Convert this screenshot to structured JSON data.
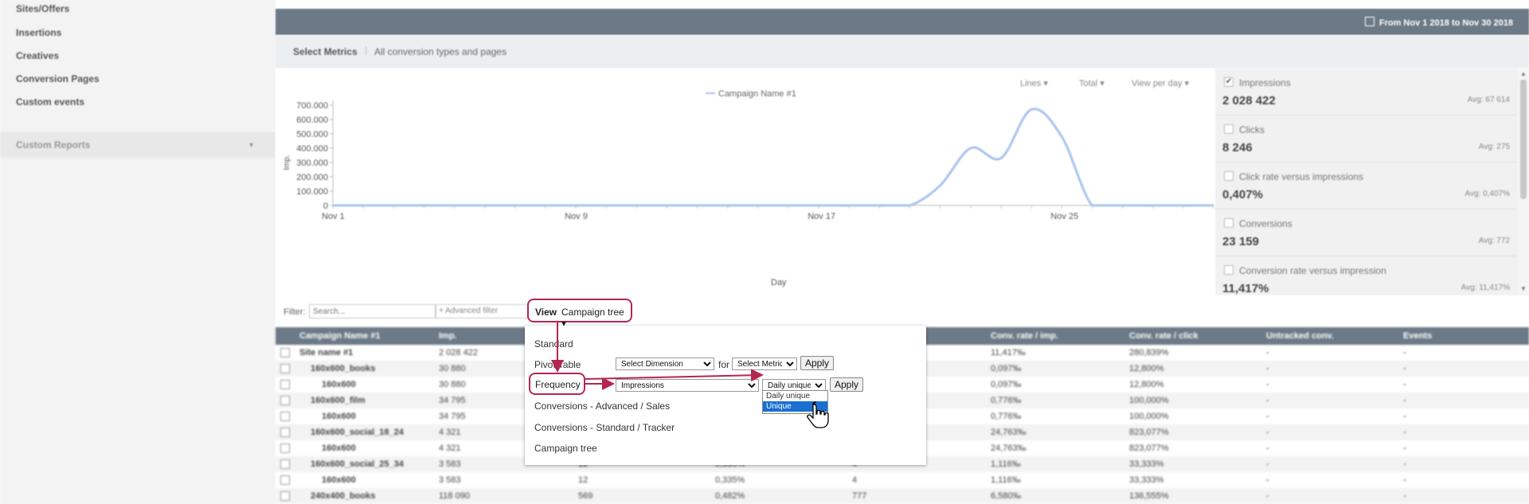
{
  "sidebar": {
    "items": [
      {
        "label": "Sites/Offers"
      },
      {
        "label": "Insertions"
      },
      {
        "label": "Creatives"
      },
      {
        "label": "Conversion Pages"
      },
      {
        "label": "Custom events"
      }
    ],
    "custom_reports": "Custom Reports"
  },
  "header": {
    "date_range": "From Nov 1 2018 to Nov 30 2018"
  },
  "metrics_bar": {
    "label": "Select Metrics",
    "separator": "|",
    "value": "All conversion types and pages"
  },
  "chart_controls": {
    "lines": "Lines ▾",
    "total": "Total ▾",
    "view": "View per day ▾"
  },
  "chart_data": {
    "type": "line",
    "legend": "Campaign Name #1",
    "xlabel": "Day",
    "ylabel": "Imp.",
    "x_ticks": [
      "Nov 1",
      "Nov 9",
      "Nov 17",
      "Nov 25"
    ],
    "y_ticks": [
      "700.000",
      "600.000",
      "500.000",
      "400.000",
      "300.000",
      "200.000",
      "100.000",
      "0"
    ],
    "ylim": [
      0,
      700000
    ],
    "series": [
      {
        "name": "Campaign Name #1",
        "color": "#a8c4ec",
        "x": [
          1,
          2,
          3,
          4,
          5,
          6,
          7,
          8,
          9,
          10,
          11,
          12,
          13,
          14,
          15,
          16,
          17,
          18,
          19,
          20,
          21,
          22,
          23,
          24,
          25,
          26,
          27,
          28,
          29,
          30
        ],
        "values": [
          0,
          0,
          0,
          0,
          0,
          0,
          0,
          0,
          0,
          0,
          0,
          0,
          0,
          0,
          0,
          0,
          0,
          0,
          0,
          0,
          140000,
          400000,
          330000,
          670000,
          480000,
          0,
          0,
          0,
          0,
          0
        ]
      }
    ]
  },
  "metric_cards": [
    {
      "name": "Impressions",
      "value": "2 028 422",
      "avg": "Avg: 67 614",
      "checked": true
    },
    {
      "name": "Clicks",
      "value": "8 246",
      "avg": "Avg: 275",
      "checked": false
    },
    {
      "name": "Click rate versus impressions",
      "value": "0,407%",
      "avg": "Avg: 0,407%",
      "checked": false
    },
    {
      "name": "Conversions",
      "value": "23 159",
      "avg": "Avg: 772",
      "checked": false
    },
    {
      "name": "Conversion rate versus impression",
      "value": "11,417%",
      "avg": "Avg: 11,417%",
      "checked": false
    }
  ],
  "filter": {
    "label": "Filter:",
    "placeholder": "Search...",
    "advanced": "+ Advanced filter"
  },
  "view": {
    "label": "View",
    "value": "Campaign tree ▾"
  },
  "dropdown": {
    "standard": "Standard",
    "pivot_table": "Pivot Table",
    "pivot_dimension": "Select Dimension",
    "pivot_for": "for",
    "pivot_metric": "Select Metric",
    "apply": "Apply",
    "frequency": "Frequency",
    "freq_metric": "Impressions",
    "freq_type": "Daily unique",
    "freq_options": [
      "Daily unique",
      "Unique"
    ],
    "conv_advanced": "Conversions - Advanced / Sales",
    "conv_standard": "Conversions - Standard / Tracker",
    "campaign_tree": "Campaign tree"
  },
  "table": {
    "headers": [
      "Campaign Name #1",
      "Imp.",
      "Conv. rate / imp.",
      "Conv. rate / click",
      "Untracked conv.",
      "Events"
    ],
    "rows": [
      {
        "name": "Site name #1",
        "imp": "2 028 422",
        "c3": "",
        "c4": "",
        "crimp": "11,417‰",
        "crclick": "280,839%",
        "untr": "-",
        "ev": "-",
        "indent": 0
      },
      {
        "name": "160x600_books",
        "imp": "30 880",
        "c3": "",
        "c4": "",
        "crimp": "0,097‰",
        "crclick": "12,800%",
        "untr": "-",
        "ev": "-",
        "indent": 1
      },
      {
        "name": "160x600",
        "imp": "30 880",
        "c3": "",
        "c4": "",
        "crimp": "0,097‰",
        "crclick": "12,800%",
        "untr": "-",
        "ev": "-",
        "indent": 2
      },
      {
        "name": "160x600_film",
        "imp": "34 795",
        "c3": "",
        "c4": "",
        "crimp": "0,776‰",
        "crclick": "100,000%",
        "untr": "-",
        "ev": "-",
        "indent": 1
      },
      {
        "name": "160x600",
        "imp": "34 795",
        "c3": "",
        "c4": "",
        "crimp": "0,776‰",
        "crclick": "100,000%",
        "untr": "-",
        "ev": "-",
        "indent": 2
      },
      {
        "name": "160x600_social_18_24",
        "imp": "4 321",
        "c3": "",
        "c4": "",
        "crimp": "24,763‰",
        "crclick": "823,077%",
        "untr": "-",
        "ev": "-",
        "indent": 1
      },
      {
        "name": "160x600",
        "imp": "4 321",
        "c3": "",
        "c4": "",
        "crimp": "24,763‰",
        "crclick": "823,077%",
        "untr": "-",
        "ev": "-",
        "indent": 2
      },
      {
        "name": "160x600_social_25_34",
        "imp": "3 583",
        "c3": "0,335%",
        "c4": "4",
        "c3b": "12",
        "crimp": "1,116‰",
        "crclick": "33,333%",
        "untr": "-",
        "ev": "-",
        "indent": 1
      },
      {
        "name": "160x600",
        "imp": "3 583",
        "c3": "0,335%",
        "c4": "4",
        "c3b": "12",
        "crimp": "1,116‰",
        "crclick": "33,333%",
        "untr": "-",
        "ev": "-",
        "indent": 2
      },
      {
        "name": "240x400_books",
        "imp": "118 090",
        "c3": "0,482%",
        "c4": "777",
        "c3b": "569",
        "crimp": "6,580‰",
        "crclick": "136,555%",
        "untr": "-",
        "ev": "-",
        "indent": 1
      }
    ]
  },
  "colors": {
    "accent_red": "#b5264f",
    "header_slate": "#6c7986",
    "line_blue": "#a8c4ec",
    "selection_blue": "#1a6fd1"
  }
}
